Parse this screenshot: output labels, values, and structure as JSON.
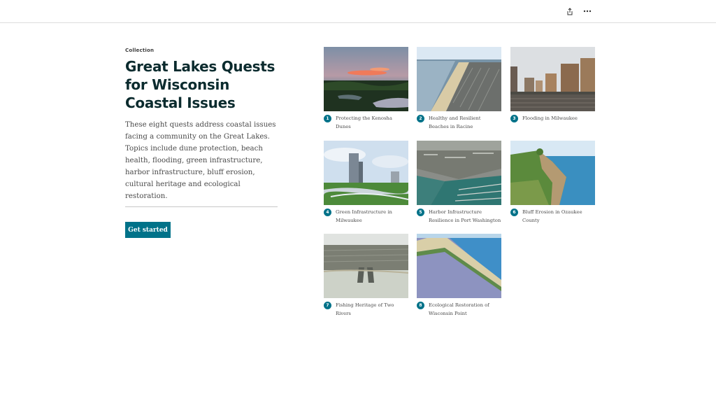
{
  "header": {
    "share_icon": "share-icon",
    "more_icon": "more-options-icon"
  },
  "collection": {
    "eyebrow": "Collection",
    "title": "Great Lakes Quests for Wisconsin Coastal Issues",
    "description": "These eight quests address coastal issues facing a community on the Great Lakes. Topics include dune protection, beach health, flooding, green infrastructure, harbor infrastructure, bluff erosion, cultural heritage and ecological restoration.",
    "cta_label": "Get started",
    "accent_color": "#007289"
  },
  "items": [
    {
      "number": "1",
      "title": "Protecting the Kenosha Dunes"
    },
    {
      "number": "2",
      "title": "Healthy and Resilient Beaches in Racine"
    },
    {
      "number": "3",
      "title": "Flooding in Milwaukee"
    },
    {
      "number": "4",
      "title": "Green Infrastructure in Milwaukee"
    },
    {
      "number": "5",
      "title": "Harbor Infrastructure Resilience in Port Washington"
    },
    {
      "number": "6",
      "title": "Bluff Erosion in Ozaukee County"
    },
    {
      "number": "7",
      "title": "Fishing Heritage of Two Rivers"
    },
    {
      "number": "8",
      "title": "Ecological Restoration of Wisconsin Point"
    }
  ]
}
